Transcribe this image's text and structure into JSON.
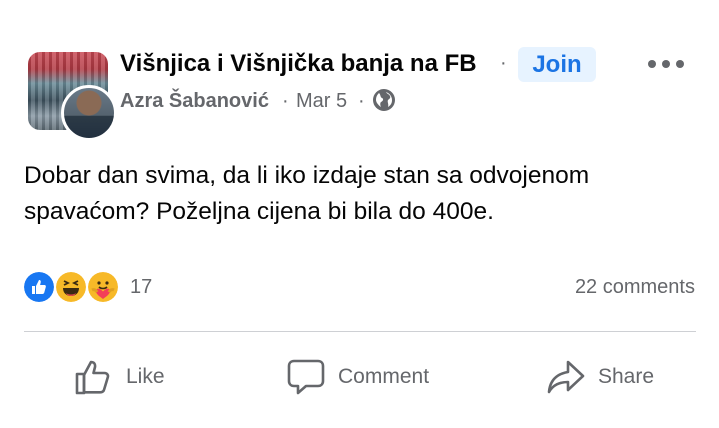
{
  "post": {
    "group_name": "Višnjica i Višnjička banja na FB",
    "separator": "·",
    "join_label": "Join",
    "author": "Azra Šabanović",
    "date": "Mar 5",
    "privacy_icon": "globe-icon",
    "text_line1": "Dobar dan svima, da li iko izdaje stan sa odvojenom",
    "text_line2": "spavaćom? Poželjna cijena bi bila do 400e."
  },
  "stats": {
    "reaction_icons": [
      "like-icon",
      "haha-icon",
      "care-icon"
    ],
    "reaction_count": "17",
    "comments": "22 comments"
  },
  "actions": {
    "like": "Like",
    "comment": "Comment",
    "share": "Share"
  },
  "colors": {
    "accent": "#1b74e4",
    "join_bg": "#e7f3ff",
    "secondary_text": "#65676b",
    "like_blue": "#1877f2",
    "emoji_yellow": "#f7b928"
  }
}
